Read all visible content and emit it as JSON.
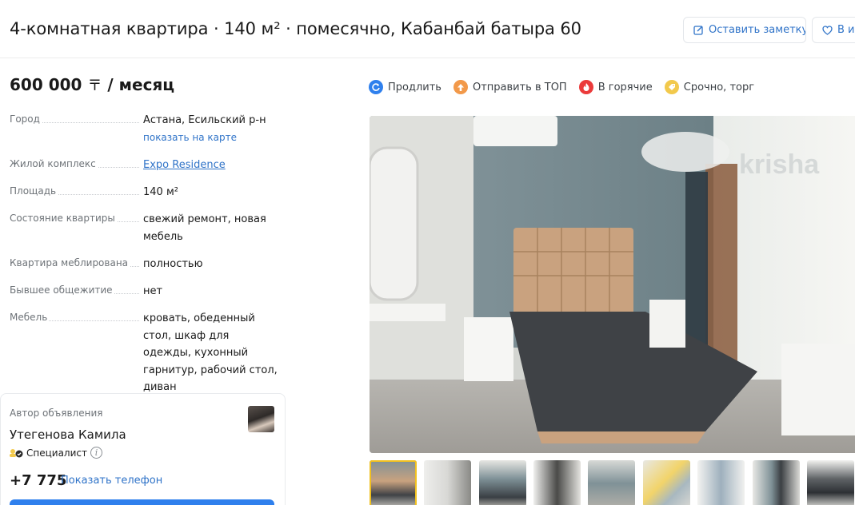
{
  "header": {
    "title": "4-комнатная квартира · 140 м² · помесячно, Кабанбай батыра 60",
    "note_button": "Оставить заметку",
    "fav_button": "В из"
  },
  "price": {
    "amount": "600 000",
    "currency": "〒",
    "period": "/ месяц"
  },
  "params": [
    {
      "label": "Город",
      "value": "Астана, Есильский р-н",
      "link": "показать на карте"
    },
    {
      "label": "Жилой комплекс",
      "value": "Expo Residence"
    },
    {
      "label": "Площадь",
      "value": "140 м²"
    },
    {
      "label": "Состояние квартиры",
      "value": "свежий ремонт, новая мебель"
    },
    {
      "label": "Квартира меблирована",
      "value": "полностью"
    },
    {
      "label": "Бывшее общежитие",
      "value": "нет"
    },
    {
      "label": "Мебель",
      "value": "кровать, обеденный стол, шкаф для одежды, кухонный гарнитур, рабочий стол, диван"
    }
  ],
  "author": {
    "caption": "Автор объявления",
    "name": "Утегенова Камила",
    "role": "Специалист",
    "info_icon": "i",
    "phone": "+7 775",
    "show_phone": "Показать телефон"
  },
  "actions": [
    {
      "label": "Продлить",
      "icon": "refresh-icon",
      "color": "#2f80ed"
    },
    {
      "label": "Отправить в ТОП",
      "icon": "arrow-up-icon",
      "color": "#f2994a"
    },
    {
      "label": "В горячие",
      "icon": "fire-icon",
      "color": "#eb3b3b"
    },
    {
      "label": "Срочно, торг",
      "icon": "tag-icon",
      "color": "#f2c94c"
    }
  ],
  "gallery": {
    "watermark": "krisha",
    "thumbnail_count": 9,
    "active_index": 0
  },
  "colors": {
    "link": "#2f73c8",
    "primary_button": "#2f80ed",
    "active_thumb": "#f0c020"
  }
}
